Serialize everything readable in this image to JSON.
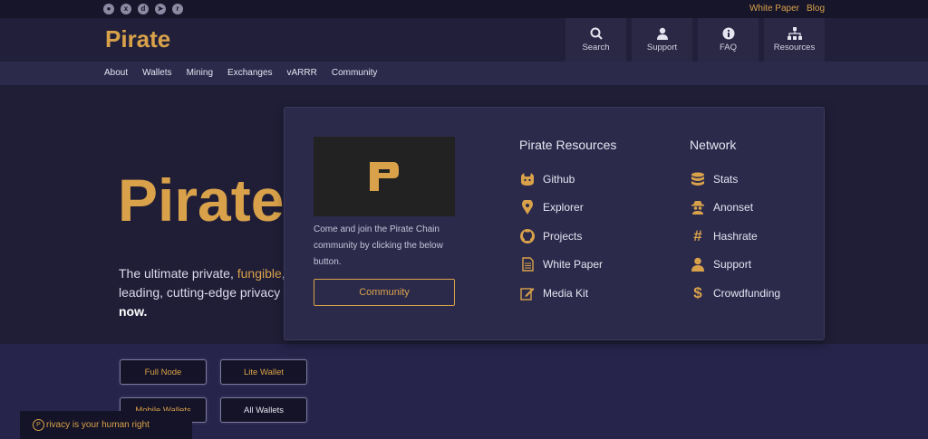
{
  "colors": {
    "accent": "#d9a24a",
    "header_bg": "#211f39",
    "nav_bg": "#2b2a4b",
    "page_bg": "#1f1d35"
  },
  "social_icons": [
    "github-icon",
    "x-icon",
    "discord-icon",
    "telegram-icon",
    "reddit-icon"
  ],
  "top_links": {
    "whitepaper": "White Paper",
    "blog": "Blog"
  },
  "brand": {
    "name": "Pirate"
  },
  "header_buttons": [
    {
      "label": "Search",
      "icon": "search-icon"
    },
    {
      "label": "Support",
      "icon": "user-icon"
    },
    {
      "label": "FAQ",
      "icon": "info-icon"
    },
    {
      "label": "Resources",
      "icon": "sitemap-icon"
    }
  ],
  "nav": [
    "About",
    "Wallets",
    "Mining",
    "Exchanges",
    "vARRR",
    "Community"
  ],
  "hero": {
    "title": "Pirate",
    "tagline_start": "The ultimate private, ",
    "tagline_highlight": "fungible",
    "tagline_mid": ", c leading, cutting-edge privacy p",
    "tagline_end": "now.",
    "buttons": {
      "full_node": "Full Node",
      "lite_wallet": "Lite Wallet",
      "mobile_wallets": "Mobile Wallets",
      "all_wallets": "All Wallets"
    }
  },
  "dropdown": {
    "promo_text": "Come and join the Pirate Chain community by clicking the below button.",
    "promo_button": "Community",
    "resources_title": "Pirate Resources",
    "resources": [
      {
        "label": "Github",
        "icon": "cat-icon"
      },
      {
        "label": "Explorer",
        "icon": "map-pin-icon"
      },
      {
        "label": "Projects",
        "icon": "github-icon"
      },
      {
        "label": "White Paper",
        "icon": "document-icon"
      },
      {
        "label": "Media Kit",
        "icon": "edit-icon"
      }
    ],
    "network_title": "Network",
    "network": [
      {
        "label": "Stats",
        "icon": "database-icon"
      },
      {
        "label": "Anonset",
        "icon": "spy-icon"
      },
      {
        "label": "Hashrate",
        "icon": "hash-icon"
      },
      {
        "label": "Support",
        "icon": "user-icon"
      },
      {
        "label": "Crowdfunding",
        "icon": "dollar-icon"
      }
    ]
  },
  "banner": {
    "text": "rivacy is your human right"
  }
}
